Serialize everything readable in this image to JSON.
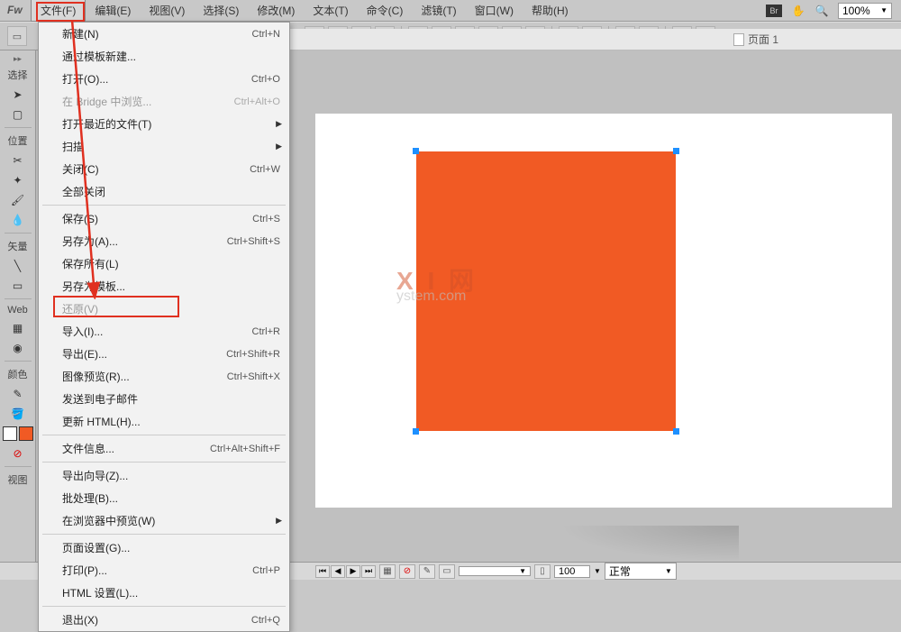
{
  "app": {
    "logo": "Fw"
  },
  "menubar": {
    "items": [
      {
        "label": "文件(F)",
        "active": true
      },
      {
        "label": "编辑(E)"
      },
      {
        "label": "视图(V)"
      },
      {
        "label": "选择(S)"
      },
      {
        "label": "修改(M)"
      },
      {
        "label": "文本(T)"
      },
      {
        "label": "命令(C)"
      },
      {
        "label": "滤镜(T)"
      },
      {
        "label": "窗口(W)"
      },
      {
        "label": "帮助(H)"
      }
    ],
    "zoom": "100%"
  },
  "dropdown": [
    {
      "label": "新建(N)",
      "shortcut": "Ctrl+N"
    },
    {
      "label": "通过模板新建..."
    },
    {
      "label": "打开(O)...",
      "shortcut": "Ctrl+O"
    },
    {
      "label": "在 Bridge 中浏览...",
      "shortcut": "Ctrl+Alt+O",
      "disabled": true
    },
    {
      "label": "打开最近的文件(T)",
      "submenu": true
    },
    {
      "label": "扫描",
      "submenu": true
    },
    {
      "label": "关闭(C)",
      "shortcut": "Ctrl+W"
    },
    {
      "label": "全部关闭"
    },
    {
      "sep": true
    },
    {
      "label": "保存(S)",
      "shortcut": "Ctrl+S"
    },
    {
      "label": "另存为(A)...",
      "shortcut": "Ctrl+Shift+S"
    },
    {
      "label": "保存所有(L)"
    },
    {
      "label": "另存为模板..."
    },
    {
      "label": "还原(V)",
      "disabled": true
    },
    {
      "label": "导入(I)...",
      "shortcut": "Ctrl+R"
    },
    {
      "label": "导出(E)...",
      "shortcut": "Ctrl+Shift+R"
    },
    {
      "label": "图像预览(R)...",
      "shortcut": "Ctrl+Shift+X"
    },
    {
      "label": "发送到电子邮件"
    },
    {
      "label": "更新 HTML(H)..."
    },
    {
      "sep": true
    },
    {
      "label": "文件信息...",
      "shortcut": "Ctrl+Alt+Shift+F"
    },
    {
      "sep": true
    },
    {
      "label": "导出向导(Z)..."
    },
    {
      "label": "批处理(B)..."
    },
    {
      "label": "在浏览器中预览(W)",
      "submenu": true
    },
    {
      "sep": true
    },
    {
      "label": "页面设置(G)..."
    },
    {
      "label": "打印(P)...",
      "shortcut": "Ctrl+P"
    },
    {
      "label": "HTML 设置(L)..."
    },
    {
      "sep": true
    },
    {
      "label": "退出(X)",
      "shortcut": "Ctrl+Q"
    }
  ],
  "left_labels": {
    "select": "选择",
    "pos": "位置",
    "vec": "矢量",
    "web": "Web",
    "color": "颜色",
    "view": "视图"
  },
  "page_tab": "页面 1",
  "watermark": {
    "line1": "X I 网",
    "line2": "ystem.com"
  },
  "statusbar": {
    "field_left": "",
    "field_num": "100",
    "mode": "正常"
  },
  "chart_data": null
}
